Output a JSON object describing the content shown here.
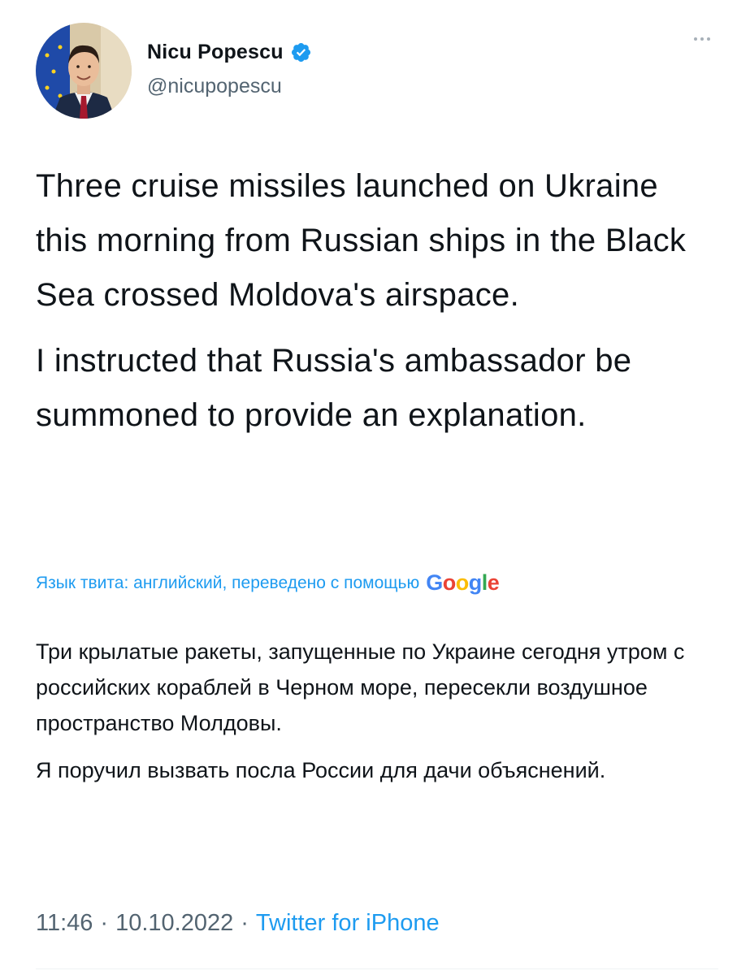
{
  "author": {
    "display_name": "Nicu Popescu",
    "handle": "@nicupopescu",
    "verified": true,
    "avatar_icon": "profile-photo-avatar"
  },
  "tweet": {
    "paragraphs": [
      "Three cruise missiles launched on Ukraine this morning from Russian ships in the Black Sea crossed Moldova's airspace.",
      "I instructed that Russia's ambassador be summoned to provide an explanation."
    ]
  },
  "translation": {
    "label": "Язык твита: английский, переведено с помощью",
    "provider": "Google",
    "paragraphs": [
      "Три крылатые ракеты, запущенные по Украине сегодня утром с российских кораблей в Черном море, пересекли воздушное пространство Молдовы.",
      "Я поручил вызвать посла России для дачи объяснений."
    ]
  },
  "meta": {
    "time": "11:46",
    "date": "10.10.2022",
    "source": "Twitter for iPhone",
    "separator": "·"
  },
  "colors": {
    "link": "#1d9bf0",
    "secondary_text": "#536471",
    "primary_text": "#0f1419"
  }
}
